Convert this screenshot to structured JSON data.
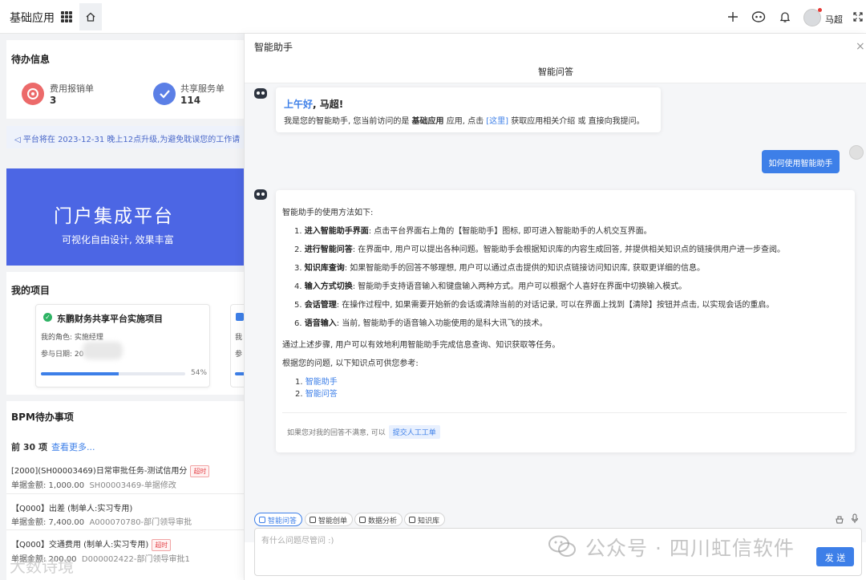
{
  "topbar": {
    "app_title": "基础应用",
    "user_name": "马超",
    "icons": [
      "apps-grid-icon",
      "home-icon",
      "plus-icon",
      "assistant-icon",
      "bell-icon",
      "avatar",
      "fullscreen-icon"
    ]
  },
  "todo": {
    "title": "待办信息",
    "items": [
      {
        "label": "费用报销单",
        "count": "3"
      },
      {
        "label": "共享服务单",
        "count": "114"
      }
    ]
  },
  "notice": "平台将在 2023-12-31 晚上12点升级,为避免耽误您的工作请",
  "banner": {
    "title": "门户集成平台",
    "subtitle": "可视化自由设计, 效果丰富"
  },
  "projects": {
    "title": "我的项目",
    "items": [
      {
        "name": "东鹏财务共享平台实施项目",
        "role": "我的角色: 实施经理",
        "date": "参与日期: 20",
        "progress_label": "54%",
        "progress": 0.54
      }
    ],
    "second_prefix_a": "我",
    "second_prefix_b": "参"
  },
  "bpm": {
    "title": "BPM待办事项",
    "count": "前 30 项",
    "more": "查看更多...",
    "items": [
      {
        "title": "[2000](SH00003469)日常审批任务-测试信用分",
        "tag": "超时",
        "amount": "单据金额: 1,000.00",
        "sub": "SH00003469-单据修改"
      },
      {
        "title": "【Q000】出差 (制单人:实习专用)",
        "tag": "",
        "amount": "单据金额: 7,400.00",
        "sub": "A000070780-部门领导审批"
      },
      {
        "title": "【Q000】交通费用 (制单人:实习专用)",
        "tag": "超时",
        "amount": "单据金额: 200.00",
        "sub": "D000002422-部门领导审批1"
      }
    ]
  },
  "assistant": {
    "title": "智能助手",
    "subtitle": "智能问答",
    "greeting_hi": "上午好",
    "greeting_name": ", 马超!",
    "intro_a": "我是您的智能助手, 您当前访问的是",
    "intro_app": "基础应用",
    "intro_b": "应用, 点击",
    "intro_link": "[这里]",
    "intro_c": "获取应用相关介绍 或 直接向我提问。",
    "user_message": "如何使用智能助手",
    "answer_intro": "智能助手的使用方法如下:",
    "answer_steps": [
      {
        "n": "1.",
        "t": "进入智能助手界面",
        "d": ": 点击平台界面右上角的【智能助手】图标, 即可进入智能助手的人机交互界面。"
      },
      {
        "n": "2.",
        "t": "进行智能问答",
        "d": ": 在界面中, 用户可以提出各种问题。智能助手会根据知识库的内容生成回答, 并提供相关知识点的链接供用户进一步查阅。"
      },
      {
        "n": "3.",
        "t": "知识库查询",
        "d": ": 如果智能助手的回答不够理想, 用户可以通过点击提供的知识点链接访问知识库, 获取更详细的信息。"
      },
      {
        "n": "4.",
        "t": "输入方式切换",
        "d": ": 智能助手支持语音输入和键盘输入两种方式。用户可以根据个人喜好在界面中切换输入模式。"
      },
      {
        "n": "5.",
        "t": "会话管理",
        "d": ": 在操作过程中, 如果需要开始新的会话或清除当前的对话记录, 可以在界面上找到【清除】按钮并点击, 以实现会话的重启。"
      },
      {
        "n": "6.",
        "t": "语音输入",
        "d": ": 当前, 智能助手的语音输入功能使用的是科大讯飞的技术。"
      }
    ],
    "answer_summary": "通过上述步骤, 用户可以有效地利用智能助手完成信息查询、知识获取等任务。",
    "answer_ref_intro": "根据您的问题, 以下知识点可供您参考:",
    "answer_refs": [
      {
        "n": "1.",
        "t": "智能助手"
      },
      {
        "n": "2.",
        "t": "智能问答"
      }
    ],
    "feedback_text": "如果您对我的回答不满意, 可以",
    "feedback_button": "提交人工工单",
    "tools": [
      "智能问答",
      "智能创单",
      "数据分析",
      "知识库"
    ],
    "input_placeholder": "有什么问题尽管问 :)",
    "send_label": "发 送"
  },
  "watermarks": {
    "wechat": "公众号 · 四川虹信软件",
    "corner": "大数诗境"
  },
  "colors": {
    "accent": "#3d7fe8",
    "banner": "#4c66e4",
    "overdue": "#e5484d"
  }
}
